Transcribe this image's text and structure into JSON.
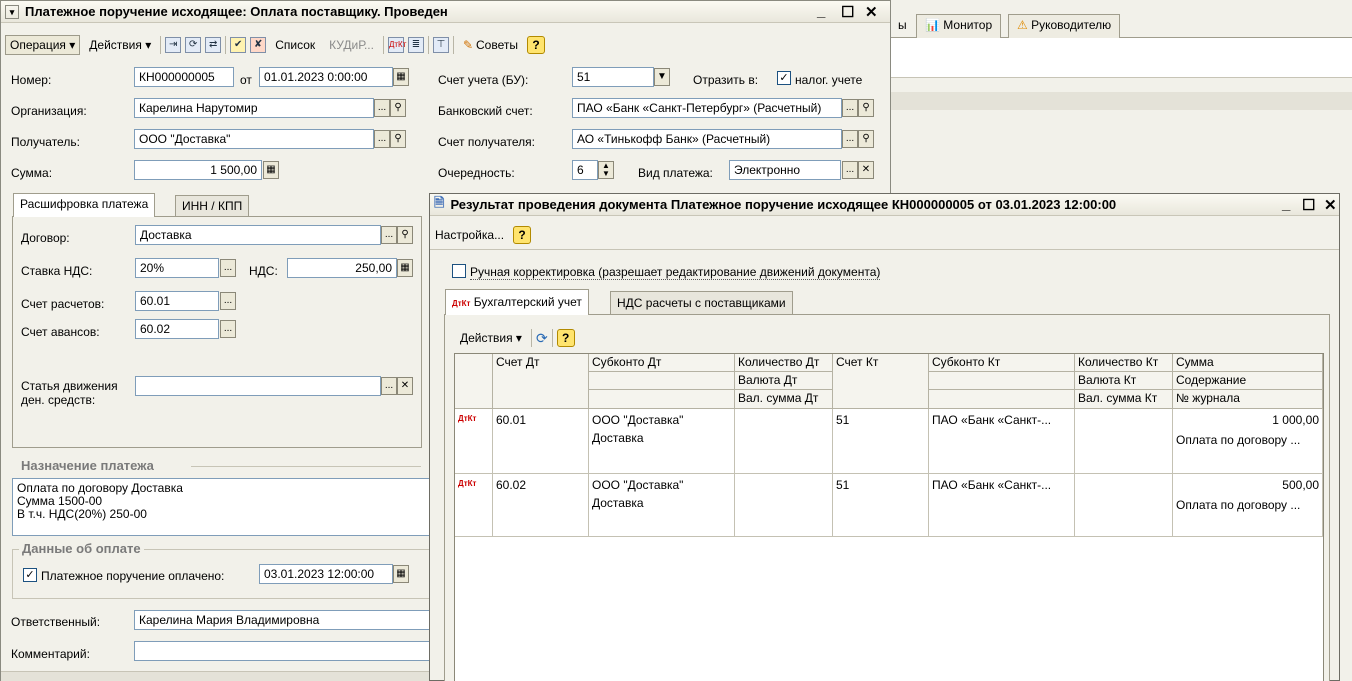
{
  "bg": {
    "tab_partial": "ы",
    "tab_monitor": "Монитор",
    "tab_manager": "Руководителю"
  },
  "main": {
    "title": "Платежное поручение исходящее: Оплата поставщику. Проведен",
    "toolbar": {
      "operation": "Операция ▾",
      "actions": "Действия ▾",
      "list": "Список",
      "kudir": "КУДиР...",
      "tips": "Советы"
    },
    "labels": {
      "number": "Номер:",
      "from": "от",
      "org": "Организация:",
      "recipient": "Получатель:",
      "sum": "Сумма:",
      "account_bu": "Счет учета (БУ):",
      "reflect": "Отразить в:",
      "tax": "налог. учете",
      "bank_account": "Банковский счет:",
      "recipient_account": "Счет получателя:",
      "priority": "Очередность:",
      "payment_type": "Вид платежа:"
    },
    "values": {
      "number": "КН000000005",
      "date": "01.01.2023  0:00:00",
      "org": "Карелина Нарутомир",
      "recipient": "ООО \"Доставка\"",
      "sum": "1 500,00",
      "account_bu": "51",
      "bank_account": "ПАО «Банк «Санкт-Петербург» (Расчетный)",
      "recipient_account": "АО «Тинькофф Банк» (Расчетный)",
      "priority": "6",
      "payment_type": "Электронно"
    },
    "tabs": [
      "Расшифровка платежа",
      "ИНН / КПП"
    ],
    "detail": {
      "contract_label": "Договор:",
      "contract": "Доставка",
      "vat_rate_label": "Ставка НДС:",
      "vat_rate": "20%",
      "vat_label": "НДС:",
      "vat": "250,00",
      "settle_label": "Счет расчетов:",
      "settle": "60.01",
      "advance_label": "Счет авансов:",
      "advance": "60.02",
      "cashflow_label": "Статья движения\nден. средств:"
    },
    "purpose_title": "Назначение платежа",
    "purpose_text": "Оплата по договору Доставка\nСумма 1500-00\nВ т.ч. НДС(20%) 250-00",
    "payment_title": "Данные об оплате",
    "paid_label": "Платежное поручение оплачено:",
    "paid_date": "03.01.2023 12:00:00",
    "responsible_label": "Ответственный:",
    "responsible": "Карелина Мария Владимировна",
    "comment_label": "Комментарий:"
  },
  "result": {
    "title": "Результат проведения документа Платежное поручение исходящее КН000000005 от 03.01.2023 12:00:00",
    "settings": "Настройка...",
    "manual_label": "Ручная корректировка (разрешает редактирование движений документа)",
    "tabs": [
      "Бухгалтерский учет",
      "НДС расчеты с поставщиками"
    ],
    "actions": "Действия ▾",
    "headers": {
      "dt": "Счет Дт",
      "sub_dt": "Субконто Дт",
      "qty_dt": "Количество Дт",
      "cur_dt": "Валюта Дт",
      "cursum_dt": "Вал. сумма Дт",
      "kt": "Счет Кт",
      "sub_kt": "Субконто Кт",
      "qty_kt": "Количество Кт",
      "cur_kt": "Валюта Кт",
      "cursum_kt": "Вал. сумма Кт",
      "sum": "Сумма",
      "content": "Содержание",
      "journal": "№ журнала"
    },
    "rows": [
      {
        "dt": "60.01",
        "sub1": "ООО \"Доставка\"",
        "sub2": "Доставка",
        "kt": "51",
        "subkt": "ПАО «Банк «Санкт-...",
        "sum": "1 000,00",
        "content": "Оплата по договору ..."
      },
      {
        "dt": "60.02",
        "sub1": "ООО \"Доставка\"",
        "sub2": "Доставка",
        "kt": "51",
        "subkt": "ПАО «Банк «Санкт-...",
        "sum": "500,00",
        "content": "Оплата по договору ..."
      }
    ]
  }
}
